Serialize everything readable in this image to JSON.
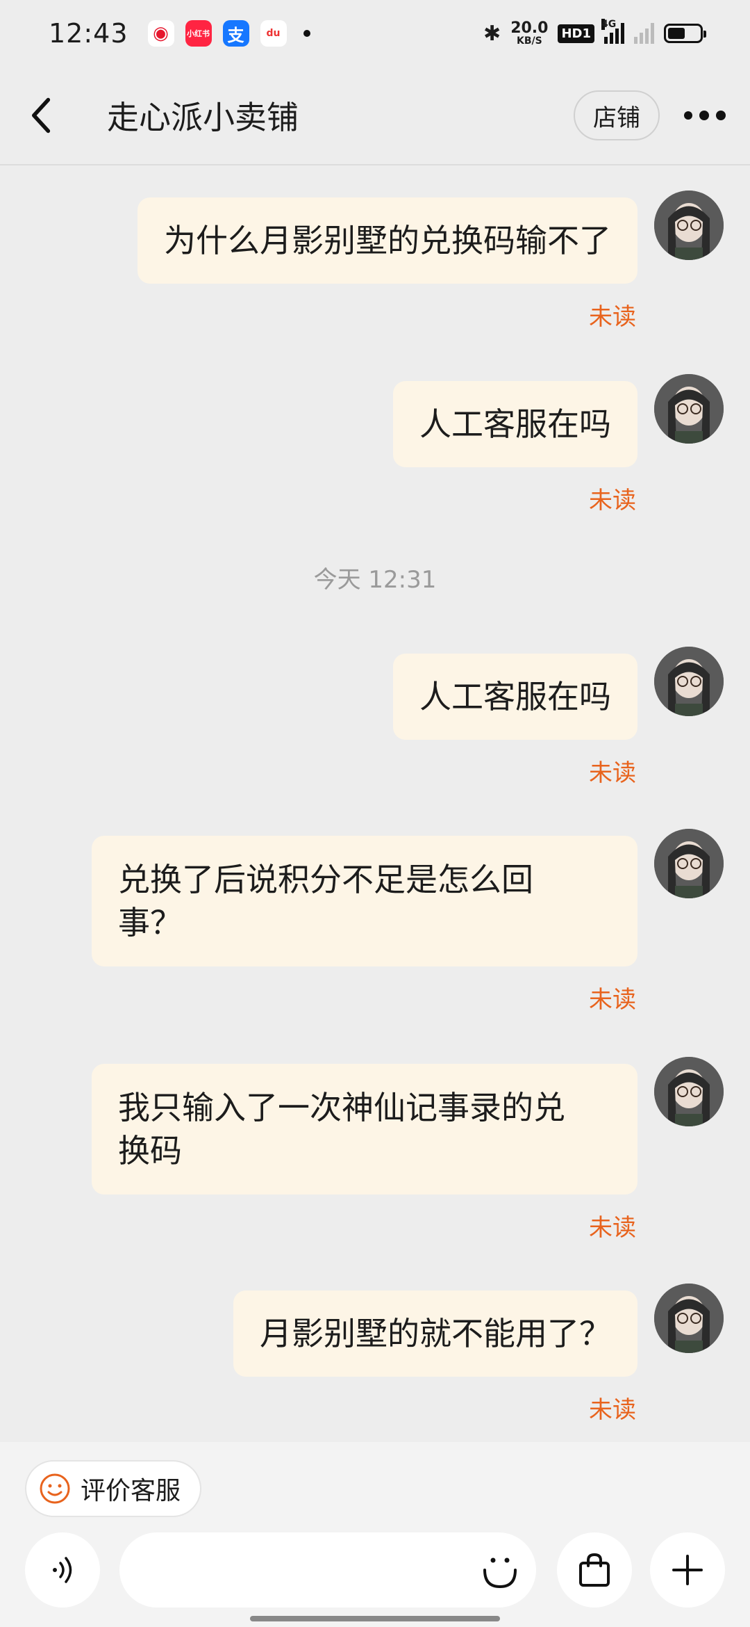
{
  "status_bar": {
    "time": "12:43",
    "apps": [
      "weibo-icon",
      "xiaohongshu-icon",
      "alipay-icon",
      "dewu-icon"
    ],
    "app_labels": {
      "xhs": "小红书",
      "alipay": "支",
      "du": "du"
    },
    "network_speed": "20.0",
    "speed_unit": "KB/S",
    "hd": "HD1",
    "network_type": "4G",
    "battery_level": 0.55
  },
  "header": {
    "title": "走心派小卖铺",
    "shop_label": "店铺"
  },
  "chat": {
    "time_divider": "今天  12:31",
    "messages": [
      {
        "text": "为什么月影别墅的兑换码输不了",
        "status": "未读"
      },
      {
        "text": "人工客服在吗",
        "status": "未读"
      },
      {
        "text": "人工客服在吗",
        "status": "未读"
      },
      {
        "text": "兑换了后说积分不足是怎么回事？",
        "line1": "兑换了后说积分不足是怎么回",
        "line2": "事？",
        "status": "未读"
      },
      {
        "text": "我只输入了一次神仙记事录的兑换码",
        "line1": "我只输入了一次神仙记事录的兑",
        "line2": "换码",
        "status": "未读"
      },
      {
        "text": "月影别墅的就不能用了？",
        "status": "未读"
      }
    ]
  },
  "bottom_bar": {
    "rate_label": "评价客服",
    "input_placeholder": "",
    "accent": "#e8631d"
  }
}
